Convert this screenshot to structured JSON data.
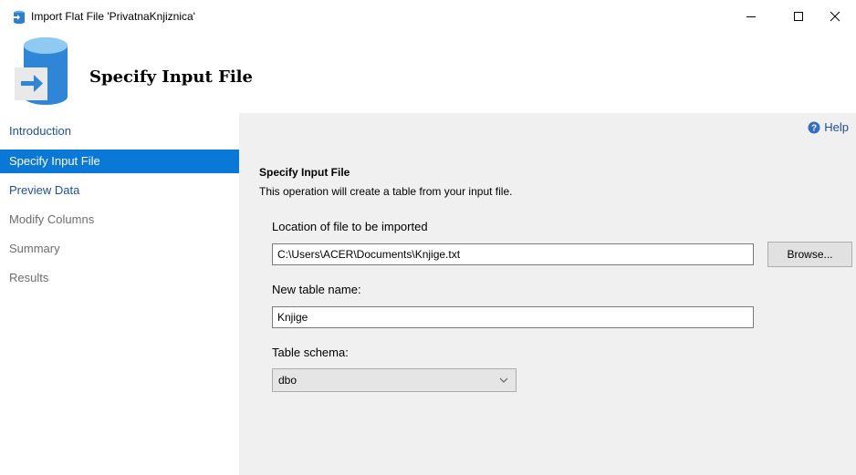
{
  "window": {
    "title": "Import Flat File 'PrivatnaKnjiznica'",
    "controls": {
      "minimize": "minimize-icon",
      "maximize": "maximize-icon",
      "close": "close-icon"
    }
  },
  "header": {
    "title": "Specify Input File",
    "icon": "database-import-icon"
  },
  "nav": {
    "items": [
      {
        "label": "Introduction",
        "state": "link"
      },
      {
        "label": "Specify Input File",
        "state": "active"
      },
      {
        "label": "Preview Data",
        "state": "link"
      },
      {
        "label": "Modify Columns",
        "state": "disabled"
      },
      {
        "label": "Summary",
        "state": "disabled"
      },
      {
        "label": "Results",
        "state": "disabled"
      }
    ]
  },
  "content": {
    "help_label": "Help",
    "section_title": "Specify Input File",
    "section_description": "This operation will create a table from your input file.",
    "location_label": "Location of file to be imported",
    "location_value": "C:\\Users\\ACER\\Documents\\Knjige.txt",
    "browse_label": "Browse...",
    "table_name_label": "New table name:",
    "table_name_value": "Knjige",
    "schema_label": "Table schema:",
    "schema_value": "dbo"
  },
  "colors": {
    "accent": "#0a78d7",
    "link": "#1e4f9a",
    "disabled_text": "#6d6d6d",
    "content_bg": "#f0f0f0"
  }
}
